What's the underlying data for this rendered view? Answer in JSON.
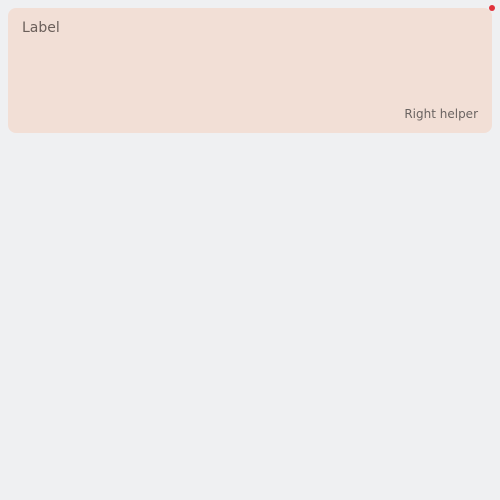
{
  "field": {
    "label": "Label",
    "value": "",
    "placeholder": "",
    "helper_right": "Right helper",
    "required": true
  },
  "colors": {
    "page_background": "#eff0f2",
    "field_background": "#f2dfd6",
    "required_indicator": "#e0323c"
  }
}
